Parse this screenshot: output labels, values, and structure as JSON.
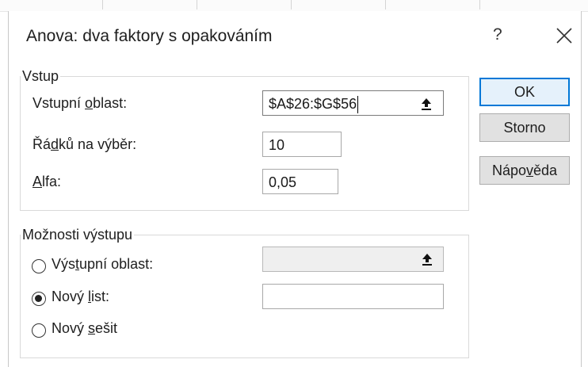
{
  "dialog": {
    "title": "Anova: dva faktory s opakováním",
    "help_label": "?",
    "close_label": "✕"
  },
  "input_group": {
    "legend": "Vstup",
    "range_label_pre": "Vstupní ",
    "range_label_key": "o",
    "range_label_post": "blast:",
    "range_value": "$A$26:$G$56",
    "rows_label_pre": "Řá",
    "rows_label_key": "d",
    "rows_label_post": "ků na výběr:",
    "rows_value": "10",
    "alpha_label_key": "A",
    "alpha_label_post": "lfa:",
    "alpha_value": "0,05"
  },
  "output_group": {
    "legend": "Možnosti výstupu",
    "options": [
      {
        "pre": "Výs",
        "key": "t",
        "post": "upní oblast:",
        "checked": false
      },
      {
        "pre": "Nový ",
        "key": "l",
        "post": "ist:",
        "checked": true
      },
      {
        "pre": "Nový ",
        "key": "s",
        "post": "ešit",
        "checked": false
      }
    ],
    "output_range_value": "",
    "new_sheet_value": ""
  },
  "buttons": {
    "ok": "OK",
    "cancel": "Storno",
    "help_pre": "Nápo",
    "help_key": "v",
    "help_post": "ěda"
  },
  "icons": {
    "range_select": "collapse-dialog-arrow-icon"
  },
  "colors": {
    "accent": "#0078d7",
    "default_button_bg": "#e5f1fb",
    "button_bg": "#e1e1e1"
  }
}
